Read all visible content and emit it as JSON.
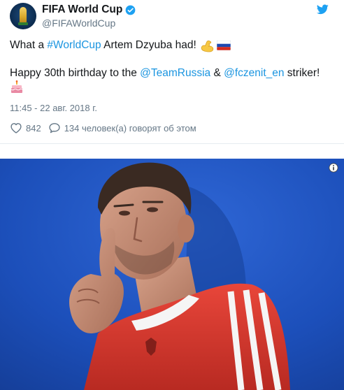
{
  "account": {
    "display_name": "FIFA World Cup",
    "handle": "@FIFAWorldCup",
    "verified": true,
    "avatar_icon": "fifa-world-cup-trophy-icon"
  },
  "tweet": {
    "line1": {
      "prefix": "What a ",
      "hashtag": "#WorldCup",
      "suffix": " Artem Dzyuba had!",
      "emojis": [
        "flexed-biceps-emoji",
        "russia-flag-emoji"
      ]
    },
    "line2": {
      "prefix": "Happy 30th birthday to the ",
      "mention1": "@TeamRussia",
      "middle": " & ",
      "mention2": "@fczenit_en",
      "suffix": " striker!",
      "emoji": "birthday-cake-emoji"
    },
    "timestamp": "11:45 - 22 авг. 2018 г."
  },
  "stats": {
    "likes": "842",
    "replies_text": "134 человек(а) говорят об этом"
  },
  "media": {
    "type": "photo",
    "info_icon": "info-icon"
  },
  "colors": {
    "link": "#1b95e0",
    "secondary_text": "#657786",
    "verified": "#1da1f2",
    "twitter_brand": "#1da1f2",
    "photo_background": "#1d4fb8",
    "jersey_red": "#e03a2f"
  }
}
